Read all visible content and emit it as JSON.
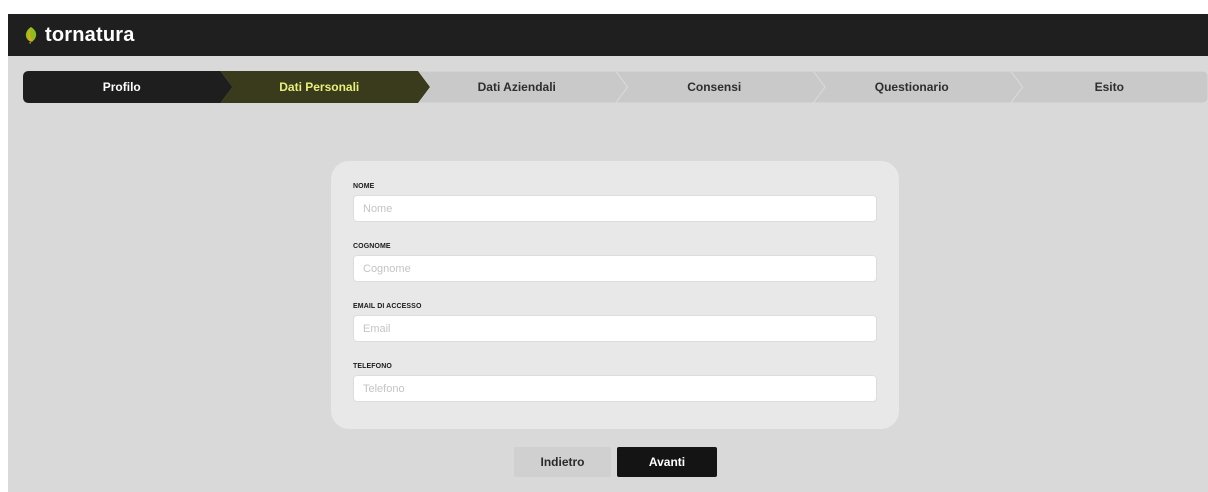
{
  "app": {
    "brand": "tornatura",
    "logo_icon": "leaf-logo-icon",
    "accent_color": "#8fbf1f"
  },
  "steps": [
    {
      "label": "Profilo",
      "state": "completed"
    },
    {
      "label": "Dati Personali",
      "state": "active"
    },
    {
      "label": "Dati Aziendali",
      "state": "upcoming"
    },
    {
      "label": "Consensi",
      "state": "upcoming"
    },
    {
      "label": "Questionario",
      "state": "upcoming"
    },
    {
      "label": "Esito",
      "state": "upcoming"
    }
  ],
  "colors": {
    "completed_bg": "#1e1e1e",
    "active_bg": "#3a3a1c",
    "active_text": "#e6f07a",
    "upcoming_bg": "#c9c9c9",
    "upcoming_text": "#2e2e2e"
  },
  "form": {
    "fields": [
      {
        "label": "NOME",
        "placeholder": "Nome",
        "value": ""
      },
      {
        "label": "COGNOME",
        "placeholder": "Cognome",
        "value": ""
      },
      {
        "label": "EMAIL DI ACCESSO",
        "placeholder": "Email",
        "value": ""
      },
      {
        "label": "TELEFONO",
        "placeholder": "Telefono",
        "value": ""
      }
    ]
  },
  "actions": {
    "back_label": "Indietro",
    "next_label": "Avanti"
  }
}
